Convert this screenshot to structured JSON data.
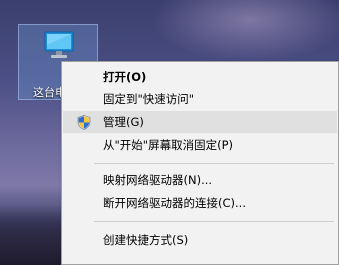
{
  "desktop": {
    "icon_label": "这台电"
  },
  "context_menu": {
    "items": [
      {
        "label": "打开(O)",
        "icon": ""
      },
      {
        "label": "固定到\"快速访问\"",
        "icon": ""
      },
      {
        "label": "管理(G)",
        "icon": "uac-shield-icon"
      },
      {
        "label": "从\"开始\"屏幕取消固定(P)",
        "icon": ""
      },
      {
        "label": "映射网络驱动器(N)...",
        "icon": ""
      },
      {
        "label": "断开网络驱动器的连接(C)...",
        "icon": ""
      },
      {
        "label": "创建快捷方式(S)",
        "icon": ""
      }
    ]
  },
  "colors": {
    "menu_bg": "#f2f2f2",
    "hover_bg": "#e0e0e0",
    "selection_bg": "#78aae6"
  }
}
